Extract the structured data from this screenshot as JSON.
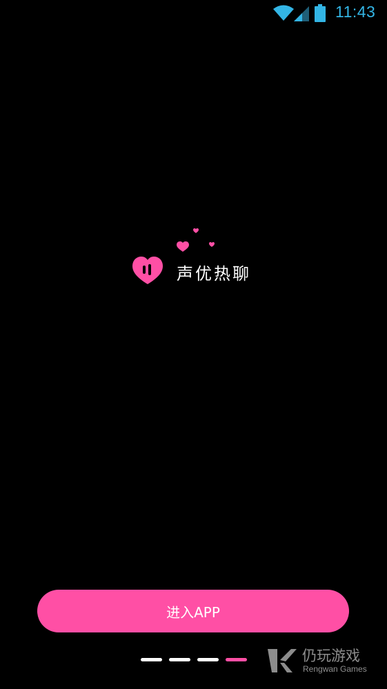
{
  "status_bar": {
    "time": "11:43",
    "icons": [
      "wifi-icon",
      "signal-icon",
      "battery-icon"
    ],
    "icon_color": "#33b5e5"
  },
  "logo": {
    "app_name": "声优热聊",
    "icon": "heart-icon",
    "brand_color": "#ff4fa5"
  },
  "enter_button": {
    "label": "进入APP",
    "color": "#ff4fa5"
  },
  "page_indicator": {
    "total": 4,
    "active_index": 3,
    "active_color": "#ff4fa5",
    "inactive_color": "#ffffff"
  },
  "watermark": {
    "text_cn": "仍玩游戏",
    "text_en": "Rengwan Games"
  }
}
